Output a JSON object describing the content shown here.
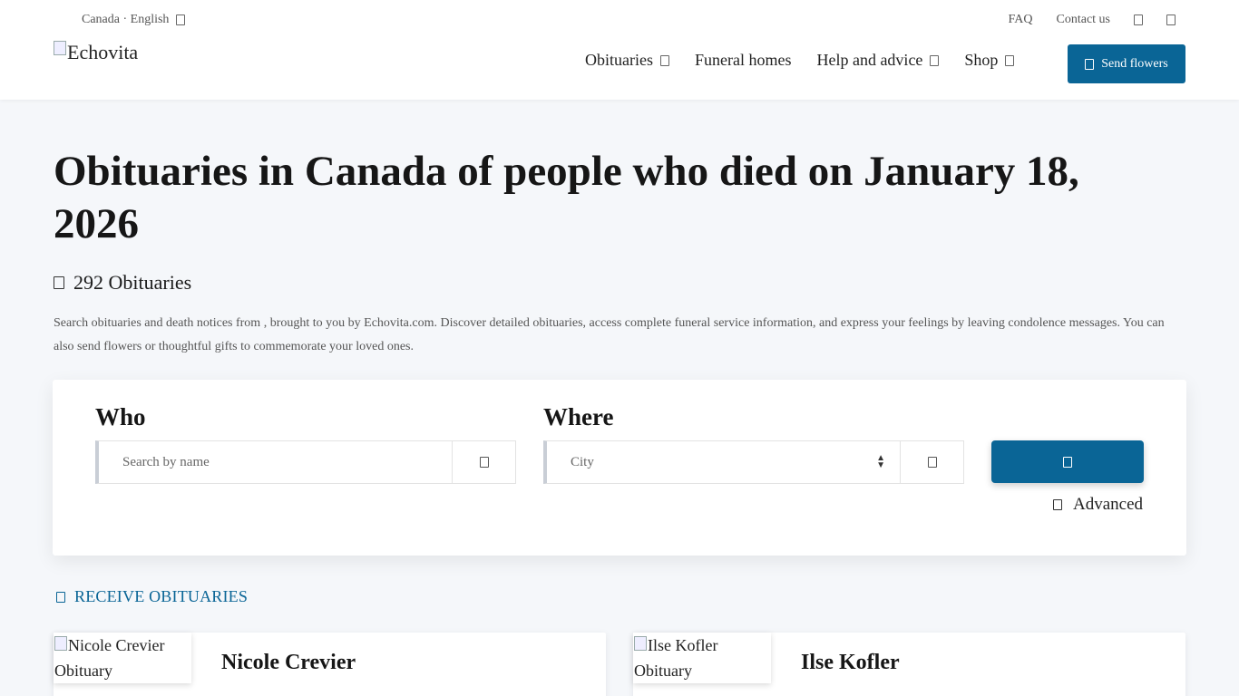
{
  "header": {
    "locale": "Canada · English",
    "top_links": [
      "FAQ",
      "Contact us"
    ],
    "logo_alt": "Echovita",
    "nav": [
      {
        "label": "Obituaries",
        "has_dropdown": true
      },
      {
        "label": "Funeral homes",
        "has_dropdown": false
      },
      {
        "label": "Help and advice",
        "has_dropdown": true
      },
      {
        "label": "Shop",
        "has_dropdown": true
      }
    ],
    "send_flowers": "Send flowers",
    "accent_color": "#0a6596"
  },
  "main": {
    "title": "Obituaries in Canada of people who died on January 18, 2026",
    "count": "292 Obituaries",
    "description": "Search obituaries and death notices from , brought to you by Echovita.com. Discover detailed obituaries, access complete funeral service information, and express your feelings by leaving condolence messages. You can also send flowers or thoughtful gifts to commemorate your loved ones."
  },
  "search": {
    "who_label": "Who",
    "who_placeholder": "Search by name",
    "where_label": "Where",
    "where_placeholder": "City",
    "advanced_label": "Advanced"
  },
  "receive_label": "RECEIVE OBITUARIES",
  "obituaries": [
    {
      "name": "Nicole Crevier",
      "photo_alt": "Nicole Crevier Obituary"
    },
    {
      "name": "Ilse Kofler",
      "photo_alt": "Ilse Kofler Obituary"
    }
  ]
}
